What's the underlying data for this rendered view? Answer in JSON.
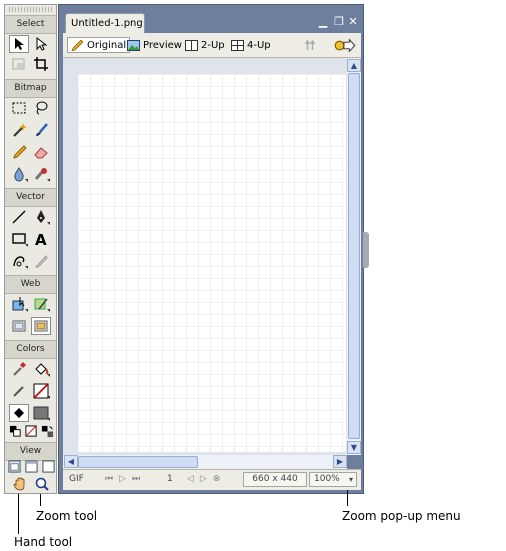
{
  "tools": {
    "sections": {
      "select": "Select",
      "bitmap": "Bitmap",
      "vector": "Vector",
      "web": "Web",
      "colors": "Colors",
      "view": "View"
    },
    "icons": [
      "pointer-icon",
      "subselect-icon",
      "scale-icon",
      "crop-icon",
      "marquee-icon",
      "lasso-icon",
      "magic-wand-icon",
      "brush-icon",
      "pencil-icon",
      "eraser-icon",
      "blur-icon",
      "rubber-stamp-icon",
      "line-icon",
      "pen-icon",
      "rectangle-icon",
      "text-icon",
      "freeform-icon",
      "knife-icon",
      "hotspot-icon",
      "slice-icon",
      "hide-slices-icon",
      "show-slices-icon",
      "eyedropper-icon",
      "paint-bucket-icon",
      "stroke-color-icon",
      "fill-color-icon",
      "standard-screen-mode-icon",
      "fullscreen-menus-icon",
      "fullscreen-icon",
      "hand-icon",
      "zoom-icon"
    ]
  },
  "document": {
    "tab_title": "Untitled-1.png",
    "views": {
      "original": "Original",
      "preview": "Preview",
      "two_up": "2-Up",
      "four_up": "4-Up"
    },
    "status": {
      "format": "GIF",
      "frame": "1",
      "size": "660 x 440",
      "zoom": "100%"
    }
  },
  "callouts": {
    "zoom_tool": "Zoom tool",
    "hand_tool": "Hand tool",
    "zoom_popup": "Zoom pop-up menu"
  },
  "colors": {
    "doc_frame": "#6d7f9c",
    "panel_bg": "#eaeae2",
    "fill_color": "#777777",
    "stroke_none": "#cc0000"
  }
}
